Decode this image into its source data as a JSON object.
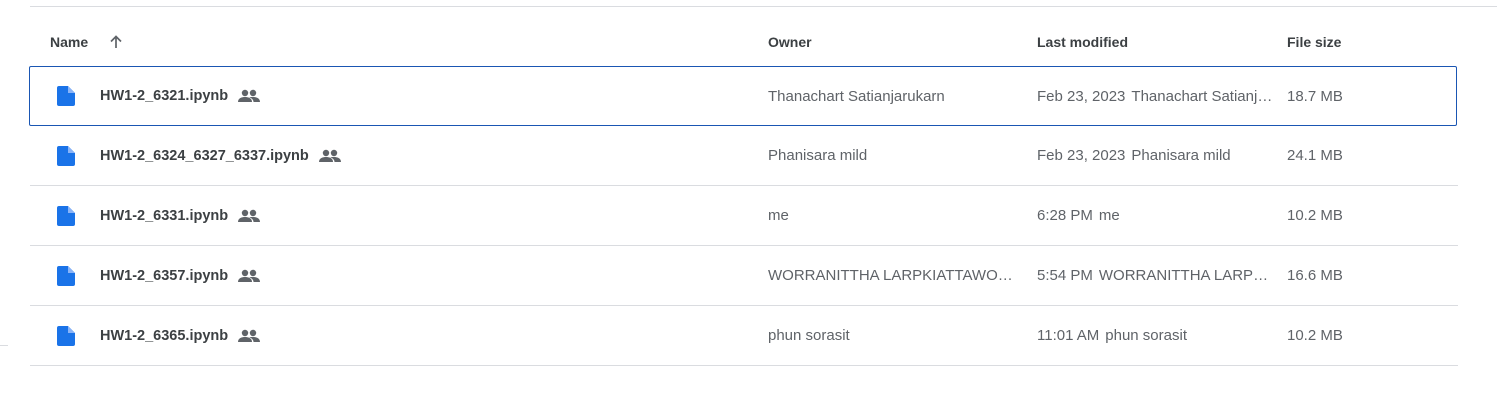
{
  "header": {
    "name_label": "Name",
    "owner_label": "Owner",
    "modified_label": "Last modified",
    "size_label": "File size"
  },
  "colors": {
    "file_icon": "#1a73e8",
    "shared_icon": "#5f6368",
    "selection_border": "#1a56b3"
  },
  "files": [
    {
      "name": "HW1-2_6321.ipynb",
      "owner": "Thanachart Satianjarukarn",
      "modified_date": "Feb 23, 2023",
      "modified_by": "Thanachart Satianjarukarn",
      "size": "18.7 MB",
      "selected": true
    },
    {
      "name": "HW1-2_6324_6327_6337.ipynb",
      "owner": "Phanisara mild",
      "modified_date": "Feb 23, 2023",
      "modified_by": "Phanisara mild",
      "size": "24.1 MB"
    },
    {
      "name": "HW1-2_6331.ipynb",
      "owner": "me",
      "modified_date": "6:28 PM",
      "modified_by": "me",
      "size": "10.2 MB"
    },
    {
      "name": "HW1-2_6357.ipynb",
      "owner": "WORRANITTHA LARPKIATTAWONG",
      "modified_date": "5:54 PM",
      "modified_by": "WORRANITTHA LARPKIATTAWONG",
      "size": "16.6 MB"
    },
    {
      "name": "HW1-2_6365.ipynb",
      "owner": "phun sorasit",
      "modified_date": "11:01 AM",
      "modified_by": "phun sorasit",
      "size": "10.2 MB"
    }
  ]
}
